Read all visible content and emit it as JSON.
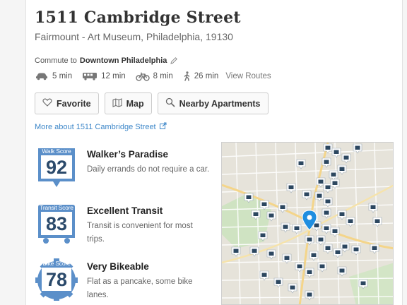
{
  "property": {
    "address": "1511 Cambridge Street",
    "location": "Fairmount - Art Museum, Philadelphia, 19130"
  },
  "commute": {
    "prefix": "Commute to",
    "destination": "Downtown Philadelphia",
    "modes": [
      {
        "icon": "car-icon",
        "time": "5 min"
      },
      {
        "icon": "bus-icon",
        "time": "12 min"
      },
      {
        "icon": "bike-icon",
        "time": "8 min"
      },
      {
        "icon": "walk-icon",
        "time": "26 min"
      }
    ],
    "view_routes": "View Routes"
  },
  "buttons": {
    "favorite": "Favorite",
    "map": "Map",
    "nearby": "Nearby Apartments"
  },
  "more_link": "More about 1511 Cambridge Street",
  "scores": [
    {
      "label": "Walk Score",
      "value": "92",
      "title": "Walker’s Paradise",
      "description": "Daily errands do not require a car."
    },
    {
      "label": "Transit Score",
      "value": "83",
      "title": "Excellent Transit",
      "description": "Transit is convenient for most trips."
    },
    {
      "label": "Bike Score",
      "value": "78",
      "title": "Very Bikeable",
      "description": "Flat as a pancake, some bike lanes."
    }
  ],
  "colors": {
    "link": "#3d87c9",
    "badge_blue": "#5b8fc9",
    "score_number": "#2b4a6b",
    "map_pin": "#1f8ee0",
    "map_marker": "#2c4760"
  }
}
